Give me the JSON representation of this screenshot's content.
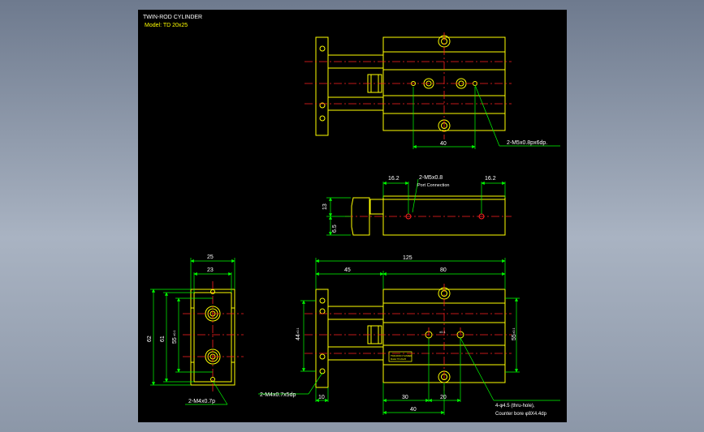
{
  "title": {
    "line1": "TWIN-ROD CYLINDER",
    "line2": "Model: TD 20x25"
  },
  "colors": {
    "background": "#000000",
    "frame": "#6e7a8e",
    "outline": "#ffff00",
    "dimension": "#00ff00",
    "centerline": "#ff2020",
    "note": "#ffffff"
  },
  "top_view": {
    "dim_40": "40",
    "port_note": "2-M5x0.8px6dp."
  },
  "side_view": {
    "dim_16_2_left": "16.2",
    "dim_16_2_right": "16.2",
    "port_size": "2-M5x0.8",
    "port_label": "Port Connection",
    "dim_13": "13",
    "dim_6_5": "6.5"
  },
  "end_view": {
    "dim_25": "25",
    "dim_23": "23",
    "dim_62": "62",
    "dim_61": "61",
    "dim_55": "55",
    "dim_55_tol": "±0.1",
    "tap_note": "2-M4x0.7p"
  },
  "front_view": {
    "dim_125": "125",
    "dim_45": "45",
    "dim_80": "80",
    "dim_44": "44",
    "dim_44_tol": "±0.1",
    "dim_55_right": "55",
    "dim_55_right_tol": "±0.1",
    "dim_10": "10",
    "dim_30": "30",
    "dim_20": "20",
    "dim_40": "40",
    "center_mark": "±0.1",
    "rear_tap_note": "2-M4x0.7x5dp",
    "hole_note": "4-φ4.5 (thru-hole),",
    "bore_note": "Counter bore φ8X4.4dp"
  }
}
